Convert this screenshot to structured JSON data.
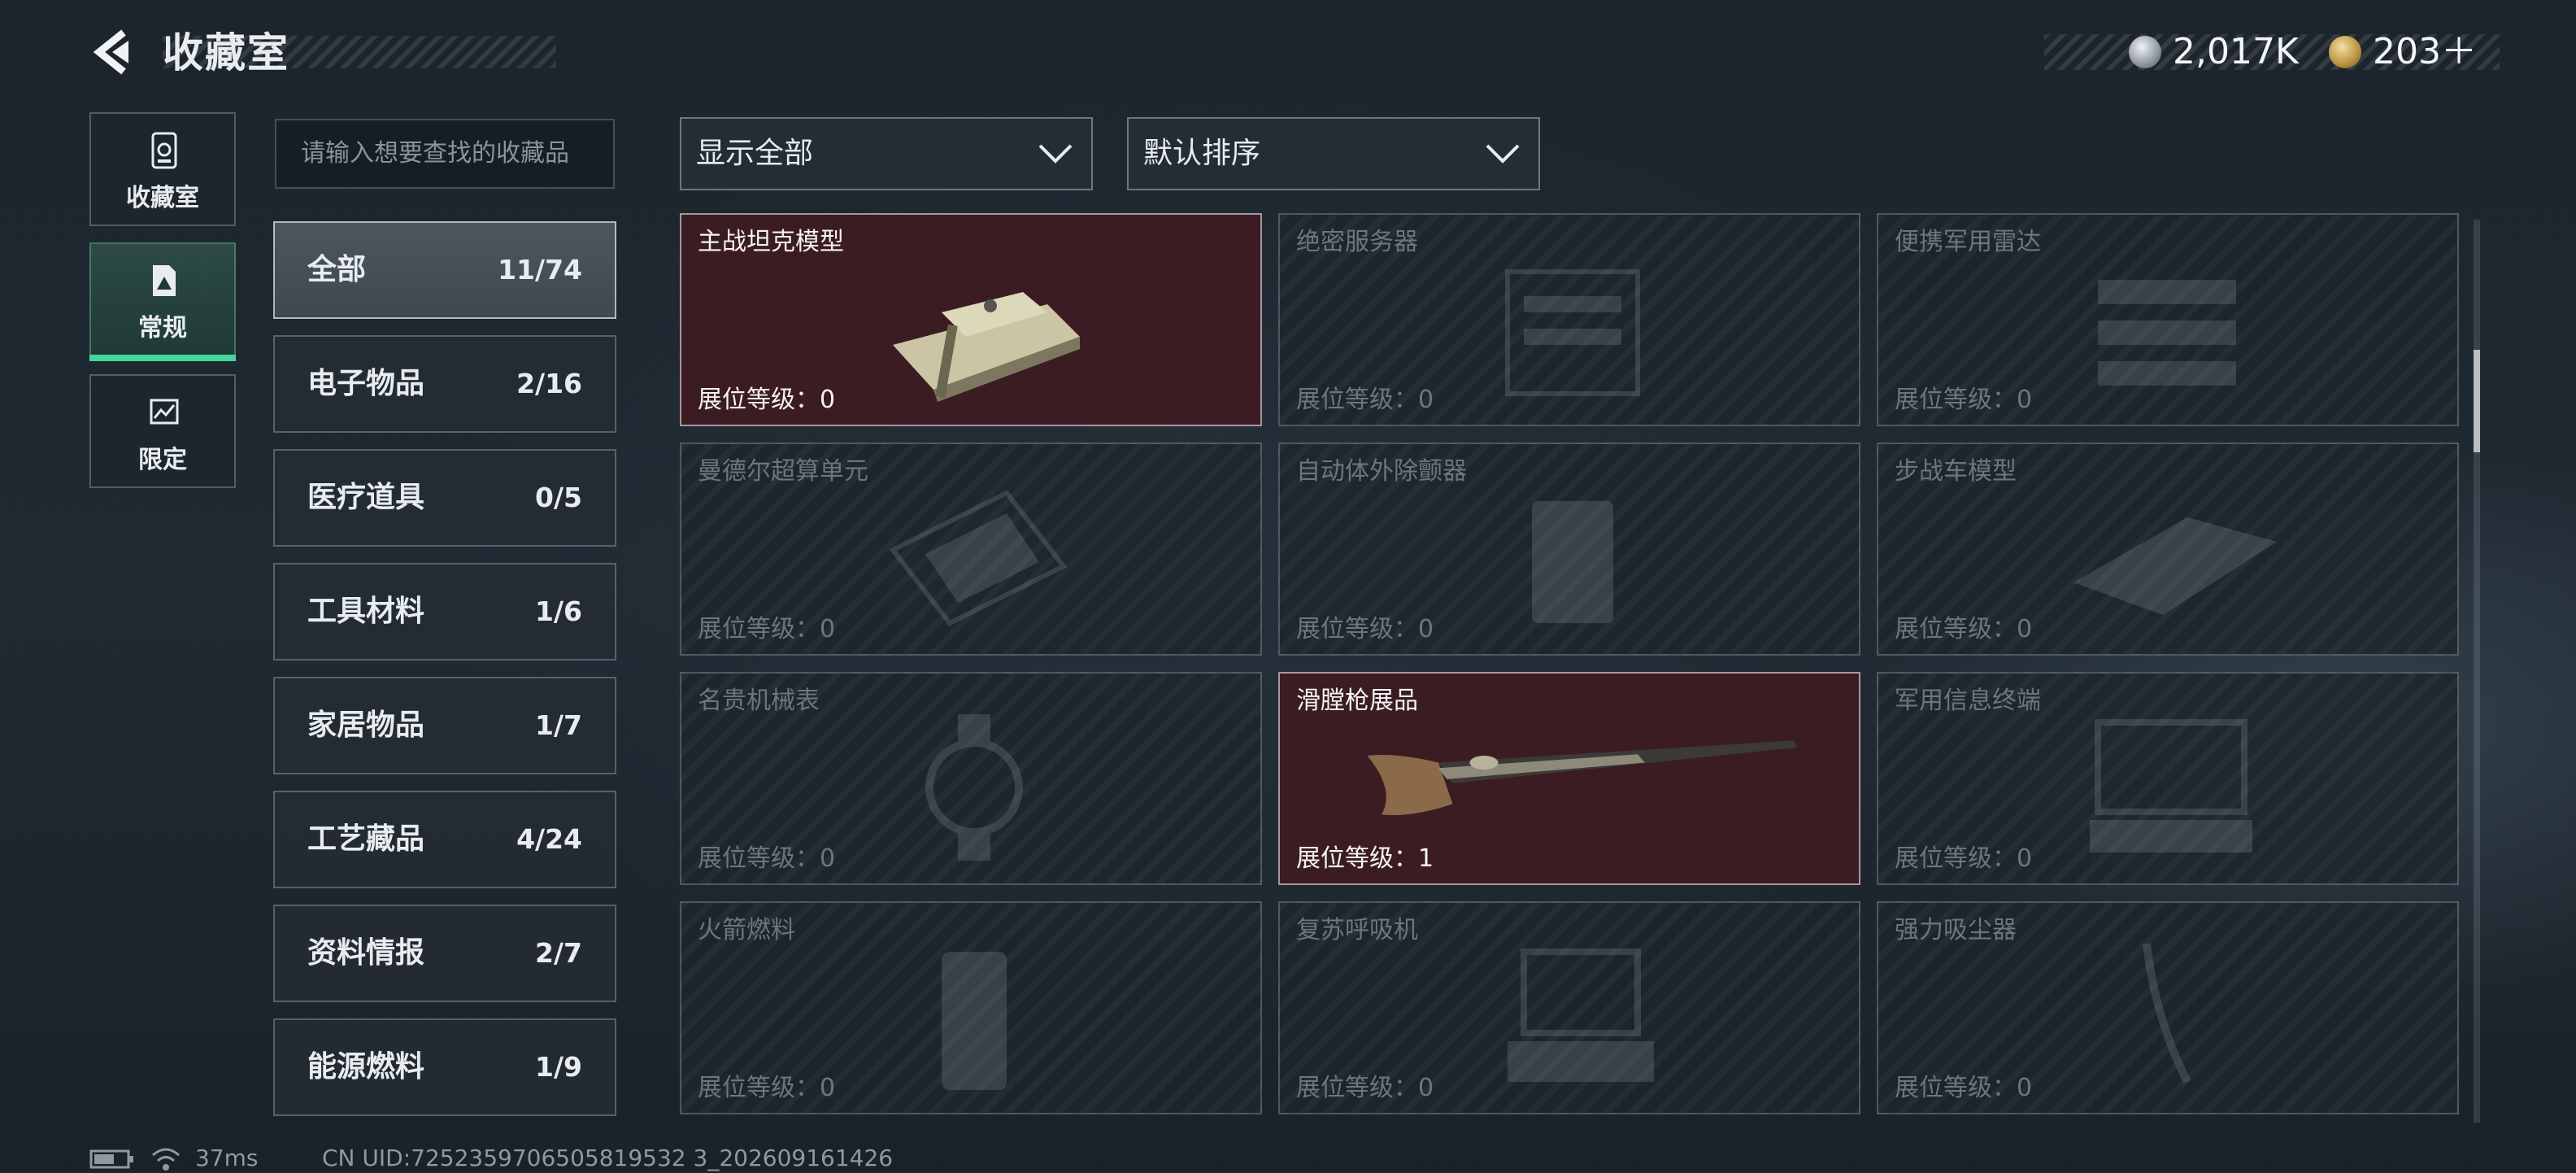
{
  "header": {
    "title": "收藏室",
    "currency_silver": "2,017K",
    "currency_gold": "203＋"
  },
  "nav": [
    {
      "label": "收藏室",
      "icon": "collection-room-icon"
    },
    {
      "label": "常规",
      "icon": "regular-icon",
      "active": true
    },
    {
      "label": "限定",
      "icon": "limited-icon"
    }
  ],
  "search": {
    "placeholder": "请输入想要查找的收藏品"
  },
  "filters": {
    "display": "显示全部",
    "sort": "默认排序"
  },
  "categories": [
    {
      "name": "全部",
      "count": "11/74",
      "active": true
    },
    {
      "name": "电子物品",
      "count": "2/16"
    },
    {
      "name": "医疗道具",
      "count": "0/5"
    },
    {
      "name": "工具材料",
      "count": "1/6"
    },
    {
      "name": "家居物品",
      "count": "1/7"
    },
    {
      "name": "工艺藏品",
      "count": "4/24"
    },
    {
      "name": "资料情报",
      "count": "2/7"
    },
    {
      "name": "能源燃料",
      "count": "1/9"
    }
  ],
  "items": [
    {
      "name": "主战坦克模型",
      "level": "展位等级：0",
      "owned": true,
      "icon": "tank-model-icon"
    },
    {
      "name": "绝密服务器",
      "level": "展位等级：0",
      "owned": false,
      "icon": "server-icon"
    },
    {
      "name": "便携军用雷达",
      "level": "展位等级：0",
      "owned": false,
      "icon": "radar-icon"
    },
    {
      "name": "曼德尔超算单元",
      "level": "展位等级：0",
      "owned": false,
      "icon": "supercomputer-icon"
    },
    {
      "name": "自动体外除颤器",
      "level": "展位等级：0",
      "owned": false,
      "icon": "defibrillator-icon"
    },
    {
      "name": "步战车模型",
      "level": "展位等级：0",
      "owned": false,
      "icon": "ifv-model-icon"
    },
    {
      "name": "名贵机械表",
      "level": "展位等级：0",
      "owned": false,
      "icon": "watch-icon"
    },
    {
      "name": "滑膛枪展品",
      "level": "展位等级：1",
      "owned": true,
      "icon": "musket-icon"
    },
    {
      "name": "军用信息终端",
      "level": "展位等级：0",
      "owned": false,
      "icon": "terminal-icon"
    },
    {
      "name": "火箭燃料",
      "level": "展位等级：0",
      "owned": false,
      "icon": "rocket-fuel-icon"
    },
    {
      "name": "复苏呼吸机",
      "level": "展位等级：0",
      "owned": false,
      "icon": "ventilator-icon"
    },
    {
      "name": "强力吸尘器",
      "level": "展位等级：0",
      "owned": false,
      "icon": "vacuum-icon"
    }
  ],
  "status": {
    "ping": "37ms",
    "uid": "CN UID:7252359706505819532 3_202609161426"
  }
}
